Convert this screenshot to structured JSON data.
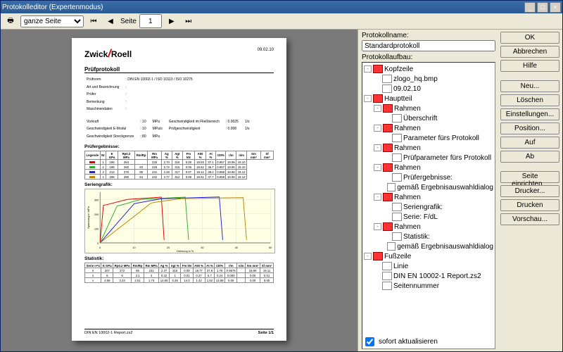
{
  "title": "Protokolleditor (Expertenmodus)",
  "toolbar": {
    "zoom": "ganze Seite",
    "page_label": "Seite",
    "page": "1"
  },
  "right": {
    "name_label": "Protokollname:",
    "name_value": "Standardprotokoll",
    "tree_label": "Protokollaufbau:",
    "refresh": "sofort aktualisieren"
  },
  "buttons": {
    "ok": "OK",
    "cancel": "Abbrechen",
    "help": "Hilfe",
    "new": "Neu...",
    "delete": "Löschen",
    "settings": "Einstellungen...",
    "position": "Position...",
    "up": "Auf",
    "down": "Ab",
    "pagesetup": "Seite einrichten...",
    "printer": "Drucker...",
    "print": "Drucken",
    "preview": "Vorschau..."
  },
  "tree": [
    {
      "d": 0,
      "tw": "-",
      "ic": "red",
      "t": "Kopfzeile"
    },
    {
      "d": 1,
      "tw": "",
      "ic": "img",
      "t": "zlogo_hq.bmp"
    },
    {
      "d": 1,
      "tw": "",
      "ic": "doc",
      "t": "09.02.10"
    },
    {
      "d": 0,
      "tw": "-",
      "ic": "red",
      "t": "Hauptteil"
    },
    {
      "d": 1,
      "tw": "-",
      "ic": "red",
      "t": "Rahmen"
    },
    {
      "d": 2,
      "tw": "",
      "ic": "doc",
      "t": "Überschrift"
    },
    {
      "d": 1,
      "tw": "-",
      "ic": "red",
      "t": "Rahmen"
    },
    {
      "d": 2,
      "tw": "",
      "ic": "doc",
      "t": "Parameter fürs Protokoll"
    },
    {
      "d": 1,
      "tw": "-",
      "ic": "red",
      "t": "Rahmen"
    },
    {
      "d": 2,
      "tw": "",
      "ic": "doc",
      "t": "Prüfparameter fürs Protokoll"
    },
    {
      "d": 1,
      "tw": "-",
      "ic": "red",
      "t": "Rahmen"
    },
    {
      "d": 2,
      "tw": "",
      "ic": "doc",
      "t": "Prüfergebnisse:"
    },
    {
      "d": 2,
      "tw": "",
      "ic": "doc",
      "t": "gemäß Ergebnisauswahldialog"
    },
    {
      "d": 1,
      "tw": "-",
      "ic": "red",
      "t": "Rahmen"
    },
    {
      "d": 2,
      "tw": "",
      "ic": "doc",
      "t": "Seriengrafik:"
    },
    {
      "d": 2,
      "tw": "",
      "ic": "doc",
      "t": "Serie: F/dL"
    },
    {
      "d": 1,
      "tw": "-",
      "ic": "red",
      "t": "Rahmen"
    },
    {
      "d": 2,
      "tw": "",
      "ic": "doc",
      "t": "Statistik:"
    },
    {
      "d": 2,
      "tw": "",
      "ic": "doc",
      "t": "gemäß Ergebnisauswahldialog"
    },
    {
      "d": 0,
      "tw": "-",
      "ic": "red",
      "t": "Fußzeile"
    },
    {
      "d": 1,
      "tw": "",
      "ic": "doc",
      "t": "Linie"
    },
    {
      "d": 1,
      "tw": "",
      "ic": "doc",
      "t": "DIN EN 10002-1 Report.zs2"
    },
    {
      "d": 1,
      "tw": "",
      "ic": "doc",
      "t": "Seitennummer"
    }
  ],
  "doc": {
    "brand_a": "Zwick",
    "brand_b": "Roell",
    "date": "09.02.10",
    "h1": "Prüfprotokoll",
    "meta_rows": [
      [
        "Prüfnorm",
        ": DIN EN 10002-1 / ISO 10113 / ISO 10275"
      ],
      [
        "Art und Bezeichnung",
        ":"
      ],
      [
        "Prüfer",
        ":"
      ],
      [
        "Bemerkung",
        ":"
      ],
      [
        "Maschinendaten",
        ":"
      ]
    ],
    "params": [
      [
        "Vorkraft",
        ": 10",
        "MPa",
        "Geschwindigkeit im Fließbereich",
        ": 0.0025",
        "1/s"
      ],
      [
        "Geschwindigkeit E-Modul",
        ": 10",
        "MPa/s",
        "Prüfgeschwindigkeit",
        ": 0.008",
        "1/s"
      ],
      [
        "Geschwindigkeit Streckgrenze",
        ": 80",
        "MPa",
        "",
        " ",
        " "
      ]
    ],
    "h2a": "Prüfergebnisse:",
    "res_head": [
      "Legende",
      "Nr",
      "E GPa",
      "Rp0.2 MPa",
      "Rm/Rp",
      "Rm MPa",
      "Ag %",
      "Agt %",
      "Fm kN",
      "A50 %",
      "At %",
      "r20%",
      "r/m",
      "n/m",
      "Sm mm²",
      "Sf mm²"
    ],
    "res_rows": [
      [
        "#d00",
        "1",
        "196",
        "264",
        "",
        "225",
        "2.70",
        "316",
        "0.06",
        "18.83",
        "37.1",
        "0.957",
        "19.96",
        "19.10"
      ],
      [
        "#3a3",
        "2",
        "198",
        "260",
        "83",
        "225",
        "2.72",
        "316",
        "0.06",
        "18.62",
        "36.7",
        "0.957",
        "19.96",
        "19.10"
      ],
      [
        "#22d",
        "3",
        "212",
        "275",
        "85",
        "231",
        "2.28",
        "317",
        "0.07",
        "19.12",
        "38.2",
        "0.958",
        "19.96",
        "19.12"
      ],
      [
        "#b80",
        "4",
        "206",
        "280",
        "84",
        "242",
        "2.77",
        "312",
        "0.08",
        "18.51",
        "37.7",
        "0.958",
        "19.96",
        "19.12"
      ]
    ],
    "h2b": "Seriengrafik:",
    "h2c": "Statistik:",
    "stat_head": [
      "Serie n=4",
      "E GPa",
      "Rp0.2 MPa",
      "Rm/Rp",
      "Rm MPa",
      "Ag %",
      "Agt %",
      "Fm kN",
      "A50 %",
      "At %",
      "r20%",
      "r/m",
      "n/m",
      "Sm mm²",
      "Sf mm²"
    ],
    "stat_rows": [
      [
        "x̄",
        "207",
        "272",
        "85",
        "231",
        "2.37",
        "316",
        "0.08",
        "18.77",
        "37.8",
        "1.78",
        "0.9575",
        "",
        "19.96",
        "19.11"
      ],
      [
        "s",
        "6",
        "6",
        "2.1",
        "4",
        "0.22",
        "1",
        "0.01",
        "0.27",
        "0.7",
        "0.24",
        "0.000",
        "",
        "0.00",
        "0.01"
      ],
      [
        "ν",
        "2.68",
        "2.24",
        "2.51",
        "1.74",
        "14.65",
        "0.36",
        "14.0",
        "1.42",
        "1.82",
        "13.58",
        "0.06",
        "",
        "0.00",
        "0.05"
      ]
    ],
    "foot_l": "DIN EN 10002-1 Report.zs2",
    "foot_r": "Seite 1/1"
  },
  "chart_data": {
    "type": "line",
    "title": "Seriengrafik:",
    "xlabel": "Dehnung in %",
    "ylabel": "Spannung in MPa",
    "xlim": [
      0,
      50
    ],
    "ylim": [
      0,
      350
    ],
    "xticks": [
      0,
      10,
      20,
      30,
      40,
      50
    ],
    "yticks": [
      0,
      100,
      200,
      300
    ],
    "series": [
      {
        "name": "1",
        "color": "#d00",
        "x": [
          0,
          1,
          2,
          8,
          18,
          18.8
        ],
        "y": [
          0,
          260,
          264,
          300,
          316,
          20
        ]
      },
      {
        "name": "2",
        "color": "#3a3",
        "x": [
          0,
          5,
          6,
          12,
          25,
          26
        ],
        "y": [
          0,
          255,
          260,
          300,
          316,
          20
        ]
      },
      {
        "name": "3",
        "color": "#22d",
        "x": [
          0,
          10,
          11,
          18,
          35,
          36
        ],
        "y": [
          0,
          270,
          275,
          305,
          317,
          20
        ]
      },
      {
        "name": "4",
        "color": "#b80",
        "x": [
          0,
          15,
          16,
          24,
          42,
          43
        ],
        "y": [
          0,
          275,
          280,
          306,
          312,
          20
        ]
      }
    ]
  }
}
